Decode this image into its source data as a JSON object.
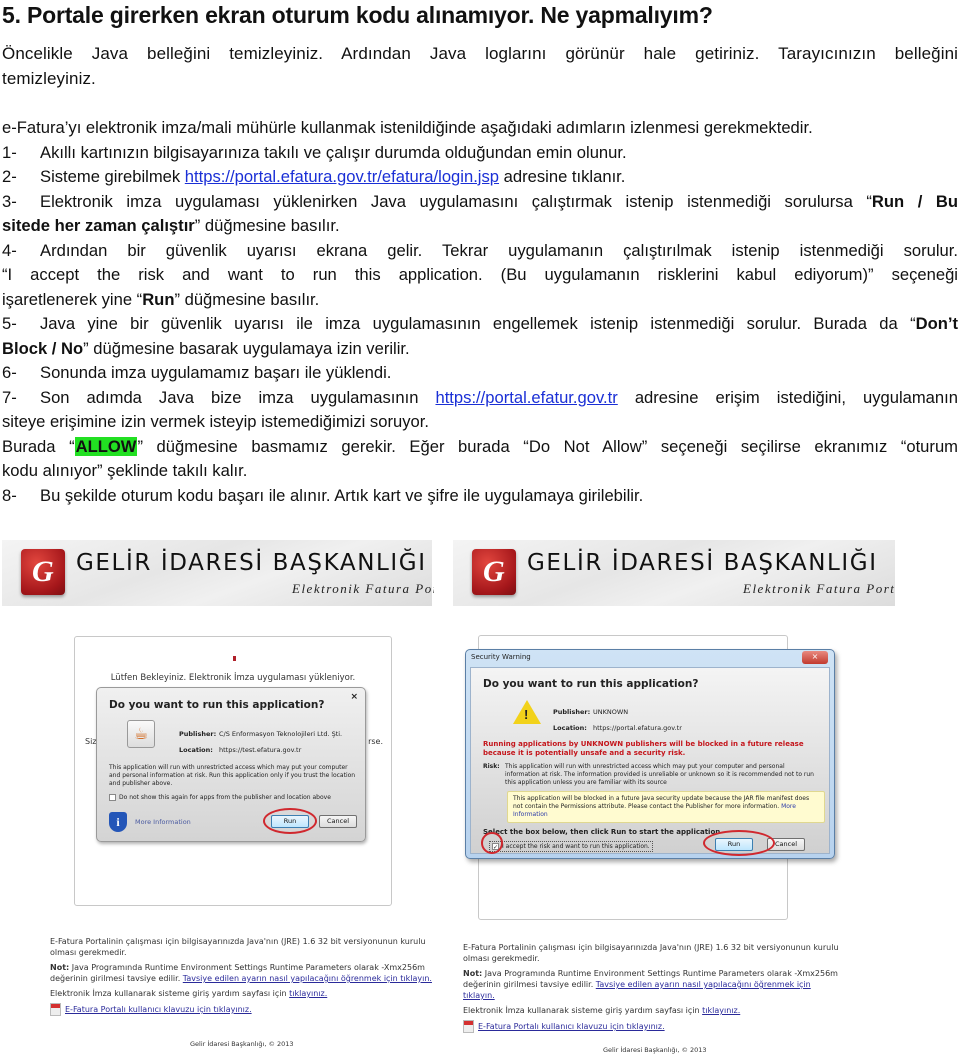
{
  "heading": "5. Portale girerken ekran oturum kodu alınamıyor. Ne yapmalıyım?",
  "intro": "Öncelikle Java belleğini temizleyiniz. Ardından Java loglarını görünür hale getiriniz.  Tarayıcınızın belleğini temizleyiniz.",
  "steps_intro": "e-Fatura’yı elektronik imza/mali mühürle kullanmak istenildiğinde aşağıdaki adımların izlenmesi gerekmektedir.",
  "steps": {
    "s1": {
      "num": "1-",
      "text": "Akıllı kartınızın bilgisayarınıza takılı ve çalışır durumda olduğundan emin olunur."
    },
    "s2": {
      "num": "2-",
      "pre": "Sisteme girebilmek ",
      "link": "https://portal.efatura.gov.tr/efatura/login.jsp",
      "post": " adresine tıklanır."
    },
    "s3": {
      "num": "3-",
      "pre": "Elektronik imza uygulaması yüklenirken Java uygulamasını çalıştırmak istenip istenmediği sorulursa “",
      "bold1": "Run / Bu",
      "bold2": "sitede her zaman çalıştır",
      "post": "” düğmesine basılır."
    },
    "s4": {
      "num": "4-",
      "line1": "Ardından bir güvenlik uyarısı ekrana gelir. Tekrar uygulamanın çalıştırılmak istenip istenmediği sorulur.",
      "line2": "“I accept the risk and want to run this application. (Bu uygulamanın risklerini kabul ediyorum)” seçeneği",
      "pre3": "işaretlenerek yine “",
      "bold": "Run",
      "post3": "” düğmesine basılır."
    },
    "s5": {
      "num": "5-",
      "pre": "Java yine bir güvenlik uyarısı ile imza uygulamasının engellemek istenip istenmediği sorulur. Burada da “",
      "bold1": "Don’t",
      "bold2": "Block / No",
      "post": "” düğmesine basarak uygulamaya izin verilir."
    },
    "s6": {
      "num": "6-",
      "text": "Sonunda imza uygulamamız başarı ile yüklendi."
    },
    "s7": {
      "num": "7-",
      "pre": "Son adımda Java bize imza uygulamasının ",
      "link": "https://portal.efatur.gov.tr",
      "post": " adresine erişim istediğini, uygulamanın",
      "line2": "siteye erişimine izin vermek isteyip istemediğimizi soruyor."
    },
    "allow": {
      "pre": "Burada  “",
      "highlight": "ALLOW",
      "post": "” düğmesine basmamız gerekir. Eğer burada “Do Not Allow” seçeneği seçilirse ekranımız “oturum",
      "line2": "kodu alınıyor” şeklinde takılı kalır.",
      "highlight_color": "#22e022"
    },
    "s8": {
      "num": "8-",
      "text": "Bu şekilde oturum kodu başarı ile alınır. Artık kart ve şifre ile uygulamaya girilebilir."
    }
  },
  "screens": {
    "banner_title": "GELİR İDARESİ BAŞKANLIĞI",
    "banner_sub_left": "Elektronik Fatura Port",
    "banner_sub_right": "Elektronik Fatura Portali",
    "logo_letter": "G",
    "left": {
      "wait_text": "Lütfen Bekleyiniz. Elektronik İmza uygulaması yükleniyor.",
      "side_left": "Size",
      "side_right": "rse.",
      "dialog": {
        "close": "×",
        "title": "Do you want to run this application?",
        "publisher_label": "Publisher:",
        "publisher": "C/S Enformasyon Teknolojileri Ltd. Şti.",
        "location_label": "Location:",
        "location": "https://test.efatura.gov.tr",
        "warning": "This application will run with unrestricted access which may put your computer and personal information at risk. Run this application only if you trust the location and publisher above.",
        "checkbox": "Do not show this again for apps from the publisher and location above",
        "more_info": "More Information",
        "run": "Run",
        "cancel": "Cancel"
      }
    },
    "right": {
      "dialog": {
        "caption": "Security Warning",
        "close": "×",
        "title": "Do you want to run this application?",
        "publisher_label": "Publisher:",
        "publisher": "UNKNOWN",
        "location_label": "Location:",
        "location": "https://portal.efatura.gov.tr",
        "red_warning": "Running applications by UNKNOWN publishers will be blocked in a future release because it is potentially unsafe and a security risk.",
        "risk_label": "Risk:",
        "risk": "This application will run with unrestricted access which may put your computer and personal information at risk. The information provided is unreliable or unknown so it is recommended not to run this application unless you are familiar with its source",
        "note": "This application will be blocked in a future Java security update because the JAR file manifest does not contain the Permissions attribute. Please contact the Publisher for more information.",
        "note_link": "More Information",
        "select_text": "Select the box below, then click Run to start the application",
        "checkbox": "I accept the risk and want to run this application.",
        "run": "Run",
        "cancel": "Cancel"
      }
    },
    "footer": {
      "java_req": "E-Fatura Portalinin çalışması için bilgisayarınızda Java'nın (JRE) 1.6 32 bit versiyonunun kurulu olması gerekmedir.",
      "note_label": "Not:",
      "note": " Java Programında Runtime Environment Settings Runtime Parameters olarak -Xmx256m değerinin girilmesi tavsiye edilir. ",
      "note_link": "Tavsiye edilen ayarın nasıl yapılacağını öğrenmek için tıklayın.",
      "help": "Elektronik İmza kullanarak sisteme giriş yardım sayfası için ",
      "help_link": "tıklayınız.",
      "guide_link": "E-Fatura Portalı kullanıcı klavuzu için tıklayınız.",
      "copyright": "Gelir İdaresi Başkanlığı, © 2013"
    }
  }
}
